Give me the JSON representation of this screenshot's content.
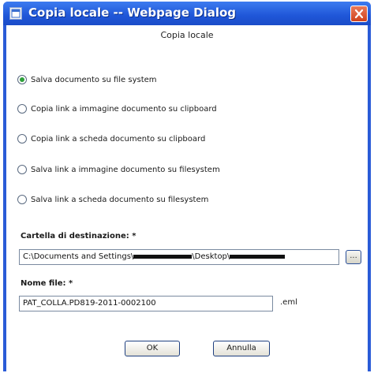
{
  "window": {
    "title": "Copia locale -- Webpage Dialog",
    "icon": "dialog-app-icon",
    "close_icon": "close-icon",
    "close_color": "#d0421c",
    "titlebar_color": "#1f56d8"
  },
  "dialog": {
    "heading": "Copia locale",
    "options": [
      {
        "label": "Salva documento su file system",
        "checked": true
      },
      {
        "label": "Copia link a immagine documento su clipboard",
        "checked": false
      },
      {
        "label": "Copia link a scheda documento su clipboard",
        "checked": false
      },
      {
        "label": "Salva link a immagine documento su filesystem",
        "checked": false
      },
      {
        "label": "Salva link a scheda documento su filesystem",
        "checked": false
      }
    ],
    "folder_label": "Cartella di destinazione: *",
    "folder_value": {
      "part1": "C:\\Documents and Settings\\",
      "part2": "\\Desktop\\"
    },
    "browse_label": "...",
    "filename_label": "Nome file: *",
    "filename_value": "PAT_COLLA.PD819-2011-0002100",
    "extension": ".eml",
    "ok_label": "OK",
    "cancel_label": "Annulla"
  }
}
